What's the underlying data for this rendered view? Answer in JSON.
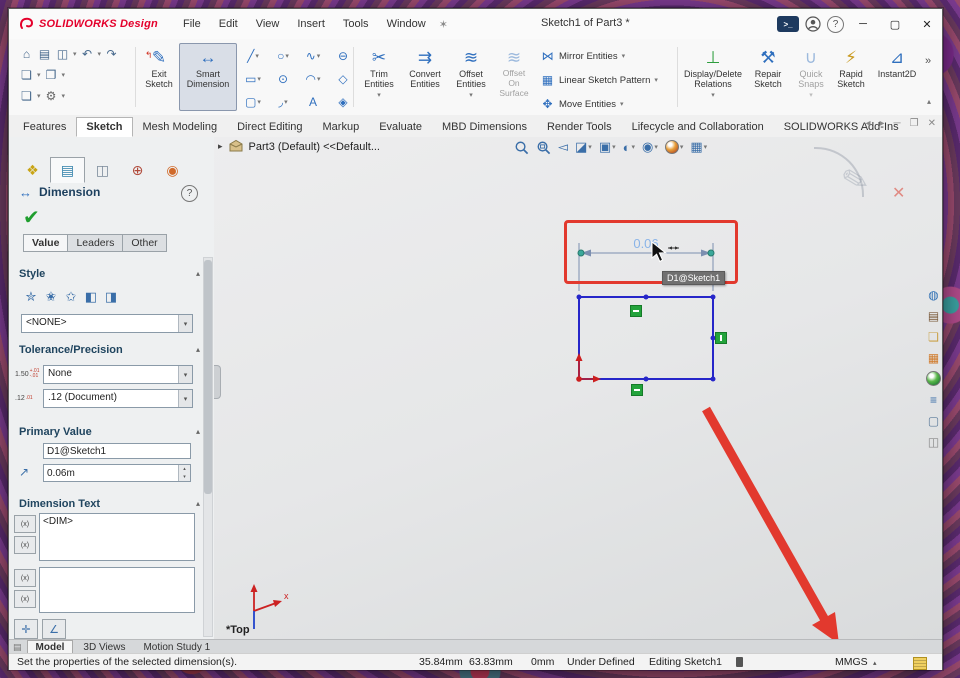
{
  "titlebar": {
    "brand": "SOLIDWORKS Design",
    "title": "Sketch1 of Part3 *",
    "menus": [
      "File",
      "Edit",
      "View",
      "Insert",
      "Tools",
      "Window"
    ]
  },
  "icons": {
    "caret": "▾",
    "caret_up": "▴",
    "flyout": "▸",
    "pin": "✶",
    "terminal": ">_",
    "help": "?",
    "min": "─",
    "max": "▢",
    "restore": "❐",
    "close": "✕",
    "panel_left": "◂",
    "panel_right": "▸",
    "home": "⌂",
    "print": "▤",
    "save": "◫",
    "undo": "↶",
    "redo": "↷",
    "newdoc": "❏",
    "opendoc": "❐",
    "gear": "⚙",
    "exit_sketch": "✎",
    "exit_arrow": "↰",
    "smart_dim": "↔",
    "line": "╱",
    "circle": "○",
    "spline": "∿",
    "ellipse": "⊖",
    "rect": "▭",
    "point": "⊙",
    "arc": "◠",
    "polygon": "◇",
    "slot": "▢",
    "fillet": "◞",
    "text_tool": "A",
    "plane": "◈",
    "trim": "✂",
    "convert": "⇉",
    "offset": "≋",
    "mirror": "⋈",
    "pattern": "▦",
    "move": "✥",
    "relations": "⊥",
    "repair": "⚒",
    "snaps": "∪",
    "rapid": "⚡",
    "instant2d": "⊿",
    "overflow": "»",
    "prev_view": "◅",
    "section": "◪",
    "orientation": "▣",
    "display_style": "◐",
    "hide_items": "◉",
    "settings_view": "▦",
    "fm_tab": "❖",
    "pm_tab": "▤",
    "cfg_tab": "◫",
    "dx_tab": "⊕",
    "dm_tab": "◉",
    "check": "✔",
    "fav1": "✮",
    "fav2": "✬",
    "fav3": "✩",
    "fav4": "◧",
    "fav5": "◨",
    "modify": "↗",
    "dim_sym": "(x)",
    "plus_sym": "✛",
    "angle_sym": "∠",
    "film": "▤",
    "resources": "◍",
    "library": "▤",
    "explorer": "❏",
    "toolbox": "▦",
    "props": "≡",
    "forum": "▢",
    "sensors": "◫"
  },
  "ribbon": {
    "exit_sketch": "Exit\nSketch",
    "smart_dimension": "Smart\nDimension",
    "trim": "Trim\nEntities",
    "convert": "Convert\nEntities",
    "offset": "Offset\nEntities",
    "offset_surface": "Offset\nOn\nSurface",
    "mirror": "Mirror Entities",
    "linear_pattern": "Linear Sketch Pattern",
    "move": "Move Entities",
    "display_delete": "Display/Delete\nRelations",
    "repair": "Repair\nSketch",
    "quick_snaps": "Quick\nSnaps",
    "rapid": "Rapid\nSketch",
    "instant2d": "Instant2D"
  },
  "tabs": [
    "Features",
    "Sketch",
    "Mesh Modeling",
    "Direct Editing",
    "Markup",
    "Evaluate",
    "MBD Dimensions",
    "Render Tools",
    "Lifecycle and Collaboration",
    "SOLIDWORKS Add-Ins"
  ],
  "tree": {
    "root": "Part3 (Default) <<Default..."
  },
  "panel": {
    "header": "Dimension",
    "tabs": [
      "Value",
      "Leaders",
      "Other"
    ],
    "style_label": "Style",
    "style_value": "<NONE>",
    "tol_label": "Tolerance/Precision",
    "tol_value": "None",
    "prec_value": ".12 (Document)",
    "tol_badge": "1.50",
    "tol_sup": "+.01",
    "tol_sub": "-.01",
    "prec_badge": ".12",
    "prec_sup": ".01",
    "primary_label": "Primary Value",
    "name_value": "D1@Sketch1",
    "dim_value": "0.06m",
    "dimtext_label": "Dimension Text",
    "dimtext_value": "<DIM>"
  },
  "canvas": {
    "dimension": "0.06",
    "tooltip": "D1@Sketch1",
    "origin": "*Top",
    "axis_x": "x"
  },
  "bottom_tabs": [
    "Model",
    "3D Views",
    "Motion Study 1"
  ],
  "status": {
    "message": "Set the properties of the selected dimension(s).",
    "x": "35.84mm",
    "y": "63.83mm",
    "z": "0mm",
    "state": "Under Defined",
    "editing": "Editing Sketch1",
    "units": "MMGS"
  }
}
